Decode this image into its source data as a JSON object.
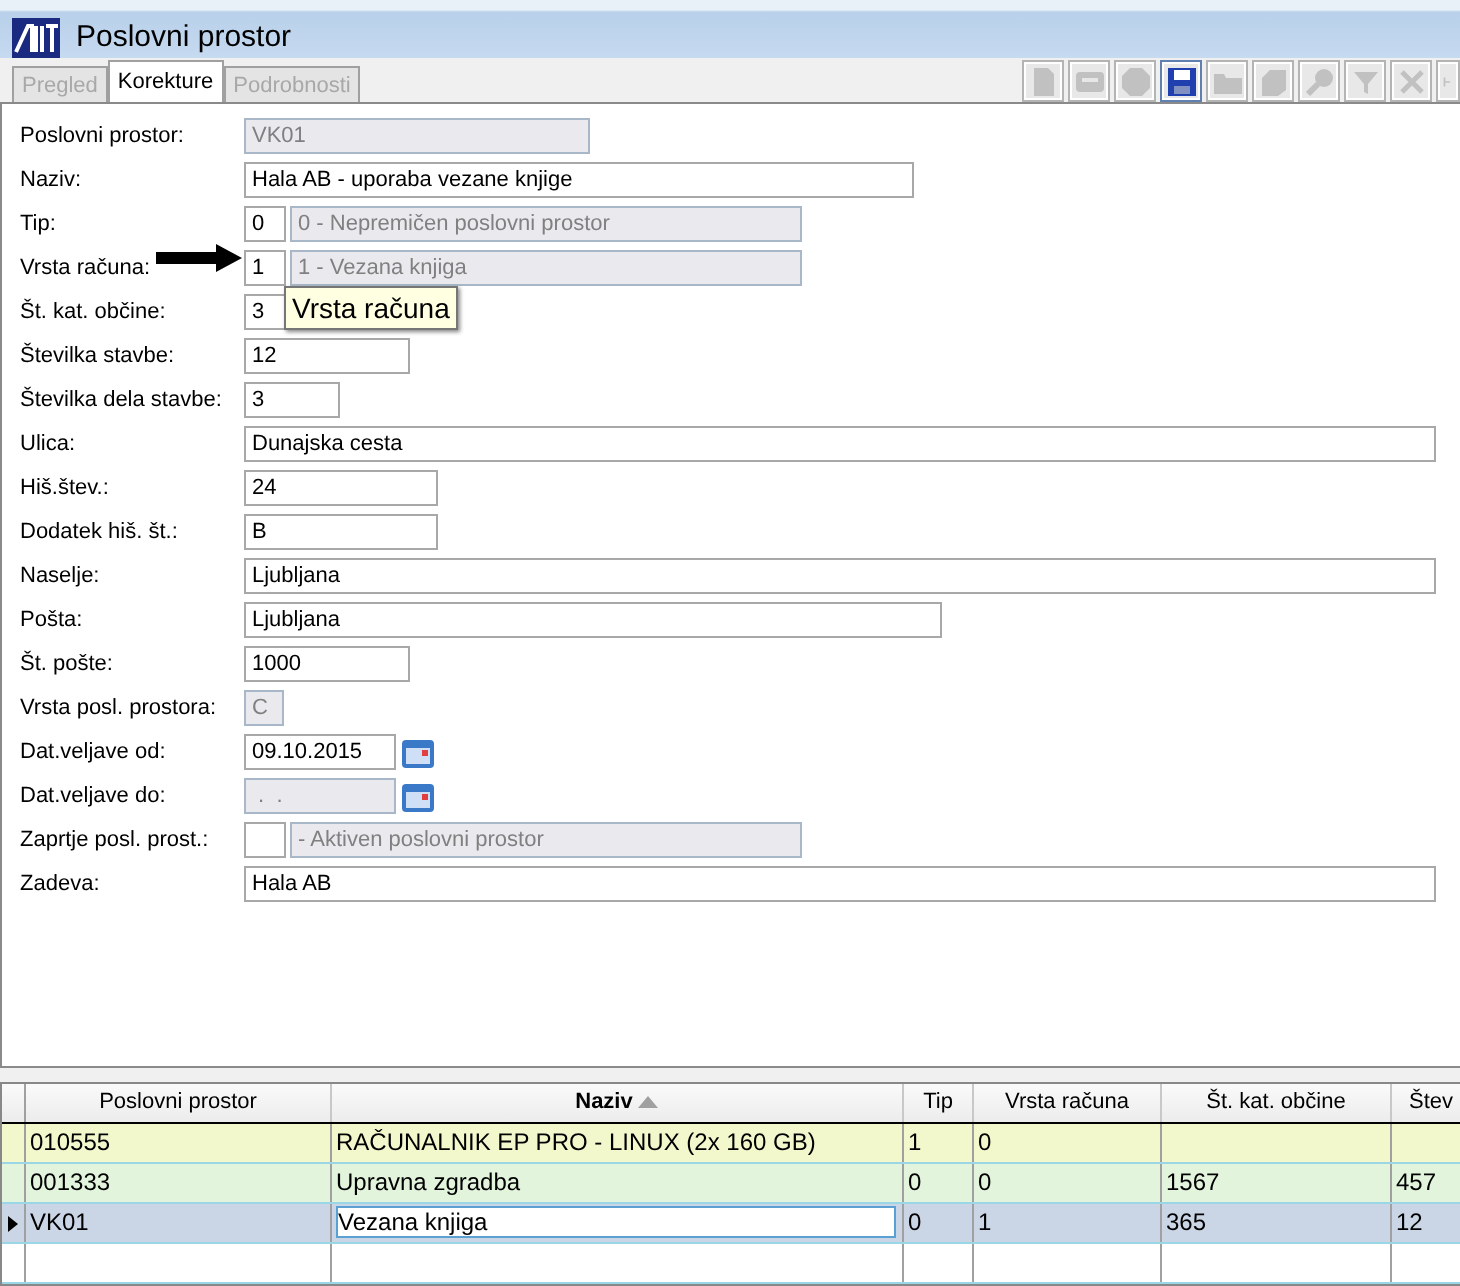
{
  "window": {
    "title": "Poslovni prostor"
  },
  "tabs": [
    {
      "label": "Pregled",
      "selected": false,
      "disabled": true
    },
    {
      "label": "Korekture",
      "selected": true,
      "disabled": false
    },
    {
      "label": "Podrobnosti",
      "selected": false,
      "disabled": true
    }
  ],
  "toolbar": [
    {
      "kind": "new",
      "disabled": true
    },
    {
      "kind": "card",
      "disabled": true
    },
    {
      "kind": "stop",
      "disabled": true
    },
    {
      "kind": "save",
      "disabled": false
    },
    {
      "kind": "open",
      "disabled": true
    },
    {
      "kind": "stack",
      "disabled": true
    },
    {
      "kind": "find",
      "disabled": true
    },
    {
      "kind": "filter",
      "disabled": true
    },
    {
      "kind": "delete",
      "disabled": true
    },
    {
      "kind": "more",
      "disabled": true
    }
  ],
  "form": [
    {
      "kind": "text",
      "label": "Poslovni prostor:",
      "value": "VK01",
      "disabled": true
    },
    {
      "kind": "text",
      "label": "Naziv:",
      "value": "Hala AB - uporaba vezane knjige",
      "disabled": false
    },
    {
      "kind": "code",
      "label": "Tip:",
      "value": "0",
      "description": "0 - Nepremičen poslovni prostor",
      "disabled": false
    },
    {
      "kind": "code",
      "label": "Vrsta računa:",
      "value": "1",
      "description": "1 - Vezana knjiga",
      "disabled": false
    },
    {
      "kind": "text",
      "label": "Št. kat. občine:",
      "value": "3",
      "disabled": false
    },
    {
      "kind": "text",
      "label": "Številka stavbe:",
      "value": "12",
      "disabled": false
    },
    {
      "kind": "text",
      "label": "Številka dela stavbe:",
      "value": "3",
      "disabled": false
    },
    {
      "kind": "text",
      "label": "Ulica:",
      "value": "Dunajska cesta",
      "disabled": false
    },
    {
      "kind": "text",
      "label": "Hiš.štev.:",
      "value": "24",
      "disabled": false
    },
    {
      "kind": "text",
      "label": "Dodatek hiš. št.:",
      "value": "B",
      "disabled": false
    },
    {
      "kind": "text",
      "label": "Naselje:",
      "value": "Ljubljana",
      "disabled": false
    },
    {
      "kind": "text",
      "label": "Pošta:",
      "value": "Ljubljana",
      "disabled": false
    },
    {
      "kind": "text",
      "label": "Št. pošte:",
      "value": "1000",
      "disabled": false
    },
    {
      "kind": "text",
      "label": "Vrsta posl. prostora:",
      "value": "C",
      "disabled": true
    },
    {
      "kind": "date",
      "label": "Dat.veljave od:",
      "value": "09.10.2015",
      "disabled": false
    },
    {
      "kind": "date",
      "label": "Dat.veljave do:",
      "value": " .  .",
      "disabled": true
    },
    {
      "kind": "code",
      "label": "Zaprtje posl. prost.:",
      "description": "- Aktiven poslovni prostor",
      "disabled": false
    },
    {
      "kind": "text",
      "label": "Zadeva:",
      "value": "Hala AB",
      "disabled": false
    }
  ],
  "tooltip": {
    "text": "Vrsta računa"
  },
  "table": {
    "columns": [
      {
        "label": "Poslovni prostor",
        "sorted": false
      },
      {
        "label": "Naziv",
        "sorted": true
      },
      {
        "label": "Tip",
        "sorted": false
      },
      {
        "label": "Vrsta računa",
        "sorted": false
      },
      {
        "label": "Št. kat. občine",
        "sorted": false
      },
      {
        "label": "Štev",
        "sorted": false
      }
    ],
    "rows": [
      {
        "cells": [
          "010555",
          "RAČUNALNIK EP PRO - LINUX (2x 160 GB)",
          "1",
          "0",
          "",
          ""
        ],
        "color": "#f2f8cc",
        "selected": false
      },
      {
        "cells": [
          "001333",
          "Upravna zgradba",
          "0",
          "0",
          "1567",
          "457"
        ],
        "color": "#e2f4dc",
        "selected": false
      },
      {
        "cells": [
          "VK01",
          "Vezana knjiga",
          "0",
          "1",
          "365",
          "12"
        ],
        "color": "#cad6e6",
        "selected": true
      }
    ]
  }
}
